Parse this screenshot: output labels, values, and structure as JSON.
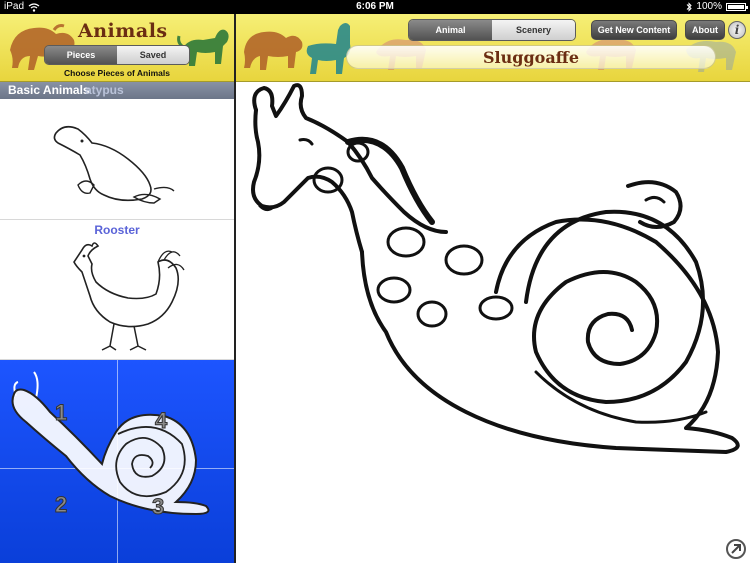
{
  "status_bar": {
    "device": "iPad",
    "time": "6:06 PM",
    "battery": "100%",
    "battery_level": 1.0
  },
  "left_header": {
    "title": "Animals",
    "segment": {
      "options": [
        "Pieces",
        "Saved"
      ],
      "selected": "Pieces"
    },
    "subtitle": "Choose Pieces of Animals"
  },
  "section": {
    "title": "Basic Animals",
    "ghost_text": "atypus"
  },
  "list": {
    "items": [
      {
        "label": ""
      },
      {
        "label": "Rooster"
      },
      {
        "label": "",
        "pieces": [
          "1",
          "2",
          "3",
          "4"
        ]
      }
    ]
  },
  "right_header": {
    "segment": {
      "options": [
        "Animal",
        "Scenery"
      ],
      "selected": "Animal"
    },
    "get_content": "Get New Content",
    "about": "About",
    "info": "i",
    "animal_name": "Sluggoaffe"
  },
  "colors": {
    "header_yellow": "#f0e25a",
    "title_brown": "#6b2d12",
    "selection_blue": "#1d55ff",
    "list_label_blue": "#5a63d8"
  },
  "icons": [
    "wifi-icon",
    "bluetooth-icon",
    "battery-icon",
    "info-icon",
    "share-icon"
  ]
}
